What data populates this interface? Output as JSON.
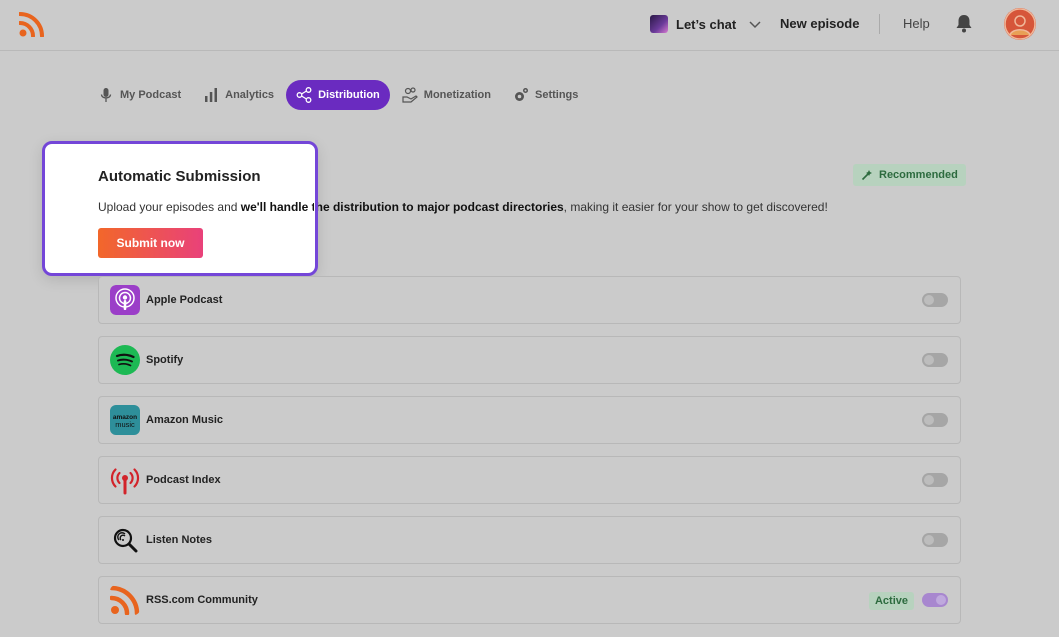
{
  "header": {
    "podcast_name": "Let’s chat",
    "new_episode": "New episode",
    "help": "Help"
  },
  "tabs": [
    {
      "label": "My Podcast",
      "icon": "microphone-icon"
    },
    {
      "label": "Analytics",
      "icon": "bar-chart-icon"
    },
    {
      "label": "Distribution",
      "icon": "share-icon",
      "active": true
    },
    {
      "label": "Monetization",
      "icon": "money-hand-icon"
    },
    {
      "label": "Settings",
      "icon": "gear-icon"
    }
  ],
  "submission": {
    "title": "Automatic Submission",
    "desc_before": "Upload your episodes and ",
    "desc_bold": "we'll handle the distribution to major podcast directories",
    "desc_after": ", making it easier for your show to get discovered!",
    "button": "Submit now",
    "recommended": "Recommended"
  },
  "directories": [
    {
      "name": "Apple Podcast",
      "icon": "apple-podcasts-icon",
      "enabled": false
    },
    {
      "name": "Spotify",
      "icon": "spotify-icon",
      "enabled": false
    },
    {
      "name": "Amazon Music",
      "icon": "amazon-music-icon",
      "enabled": false
    },
    {
      "name": "Podcast Index",
      "icon": "podcast-index-icon",
      "enabled": false
    },
    {
      "name": "Listen Notes",
      "icon": "listen-notes-icon",
      "enabled": false
    },
    {
      "name": "RSS.com Community",
      "icon": "rss-icon",
      "enabled": true,
      "badge": "Active"
    }
  ],
  "colors": {
    "accent": "#6a2bc0",
    "popover_border": "#7446d8",
    "button_start": "#f2672a",
    "button_end": "#e9417a",
    "badge_bg": "#b7d2be",
    "badge_text": "#2d6b3f"
  },
  "amazon_logo_text": [
    "amazon",
    "music"
  ]
}
